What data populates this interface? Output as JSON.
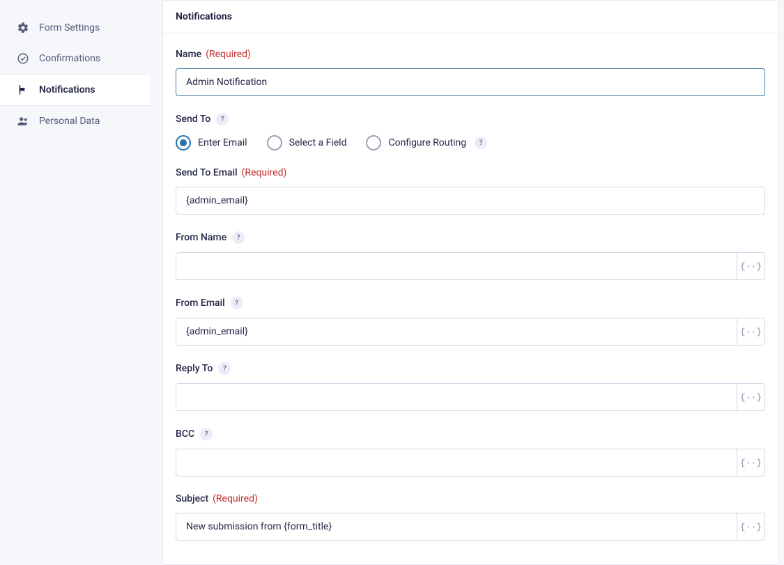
{
  "sidebar": {
    "items": [
      {
        "label": "Form Settings",
        "icon": "gear-icon",
        "active": false
      },
      {
        "label": "Confirmations",
        "icon": "check-circle-icon",
        "active": false
      },
      {
        "label": "Notifications",
        "icon": "flag-icon",
        "active": true
      },
      {
        "label": "Personal Data",
        "icon": "users-icon",
        "active": false
      }
    ]
  },
  "panel": {
    "title": "Notifications"
  },
  "labels": {
    "name": "Name",
    "required": "(Required)",
    "send_to": "Send To",
    "send_to_email": "Send To Email",
    "from_name": "From Name",
    "from_email": "From Email",
    "reply_to": "Reply To",
    "bcc": "BCC",
    "subject": "Subject"
  },
  "radios": {
    "enter_email": "Enter Email",
    "select_field": "Select a Field",
    "configure_routing": "Configure Routing"
  },
  "values": {
    "name": "Admin Notification",
    "send_to_email": "{admin_email}",
    "from_name": "",
    "from_email": "{admin_email}",
    "reply_to": "",
    "bcc": "",
    "subject": "New submission from {form_title}"
  },
  "merge_glyph": "{··}"
}
